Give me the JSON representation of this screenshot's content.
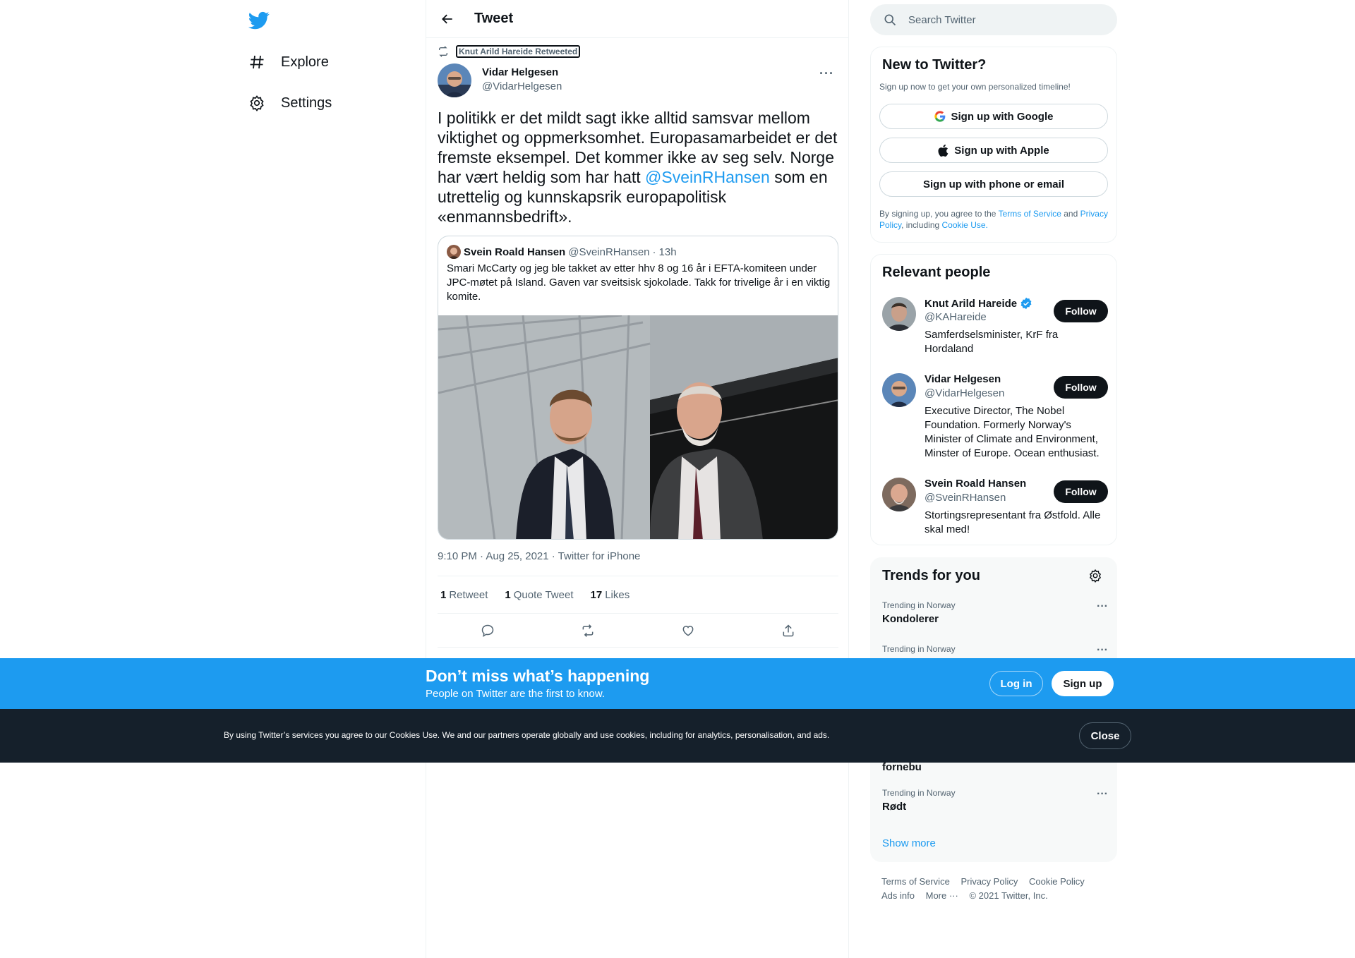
{
  "nav": {
    "logo": "twitter-bird-icon",
    "items": [
      {
        "label": "Explore",
        "icon": "hashtag-icon"
      },
      {
        "label": "Settings",
        "icon": "gear-icon"
      }
    ]
  },
  "header": {
    "title": "Tweet"
  },
  "tweet": {
    "retweeted_by": "Knut Arild Hareide Retweeted",
    "author_name": "Vidar Helgesen",
    "author_handle": "@VidarHelgesen",
    "text_before": "I politikk er det mildt sagt ikke alltid samsvar mellom viktighet og oppmerksomhet. Europasamarbeidet er det fremste eksempel. Det kommer ikke av seg selv. Norge har vært heldig som har hatt ",
    "mention": "@SveinRHansen",
    "text_after": " som en utrettelig og kunnskapsrik europapolitisk «enmannsbedrift».",
    "meta": "9:10 PM · Aug 25, 2021 · Twitter for iPhone",
    "stats": {
      "retweets_count": "1",
      "retweets_label": "Retweet",
      "quotes_count": "1",
      "quotes_label": "Quote Tweet",
      "likes_count": "17",
      "likes_label": "Likes"
    },
    "quote": {
      "name": "Svein Roald Hansen",
      "handle": "@SveinRHansen",
      "sep": "·",
      "time": "13h",
      "text": "Smari McCarty og jeg ble takket av etter hhv 8 og 16 år i EFTA-komiteen under JPC-møtet på Island. Gaven var sveitsisk sjokolade. Takk for trivelige år i en viktig komite."
    }
  },
  "search": {
    "placeholder": "Search Twitter"
  },
  "new_to_twitter": {
    "title": "New to Twitter?",
    "subtitle": "Sign up now to get your own personalized timeline!",
    "google": "Sign up with Google",
    "apple": "Sign up with Apple",
    "phone": "Sign up with phone or email",
    "terms_1": "By signing up, you agree to the ",
    "terms_link": "Terms of Service",
    "terms_2": " and ",
    "privacy_link": "Privacy Policy",
    "terms_3": ", including ",
    "cookie_link": "Cookie Use."
  },
  "relevant_people": {
    "title": "Relevant people",
    "follow_label": "Follow",
    "people": [
      {
        "name": "Knut Arild Hareide",
        "handle": "@KAHareide",
        "bio": "Samferdselsminister, KrF fra Hordaland",
        "verified": true
      },
      {
        "name": "Vidar Helgesen",
        "handle": "@VidarHelgesen",
        "bio": "Executive Director, The Nobel Foundation. Formerly Norway's Minister of Climate and Environment, Minster of Europe. Ocean enthusiast.",
        "verified": false
      },
      {
        "name": "Svein Roald Hansen",
        "handle": "@SveinRHansen",
        "bio": "Stortingsrepresentant fra Østfold. Alle skal med!",
        "verified": false
      }
    ]
  },
  "trends": {
    "title": "Trends for you",
    "items": [
      {
        "context": "Trending in Norway",
        "name": "Kondolerer"
      },
      {
        "context": "Trending in Norway",
        "name": ""
      },
      {
        "context": "",
        "name": "fornebu"
      },
      {
        "context": "Trending in Norway",
        "name": "Rødt"
      }
    ],
    "show_more": "Show more"
  },
  "footer": {
    "terms": "Terms of Service",
    "privacy": "Privacy Policy",
    "cookie": "Cookie Policy",
    "ads": "Ads info",
    "more": "More ···",
    "copyright": "© 2021 Twitter, Inc."
  },
  "banner": {
    "title": "Don’t miss what’s happening",
    "subtitle": "People on Twitter are the first to know.",
    "login": "Log in",
    "signup": "Sign up"
  },
  "cookie_bar": {
    "text": "By using Twitter’s services you agree to our Cookies Use. We and our partners operate globally and use cookies, including for analytics, personalisation, and ads.",
    "close": "Close"
  },
  "colors": {
    "accent": "#1d9bf0",
    "text": "#0f1419",
    "muted": "#536471",
    "border": "#eff3f4",
    "cookie_bg": "#15202b"
  }
}
